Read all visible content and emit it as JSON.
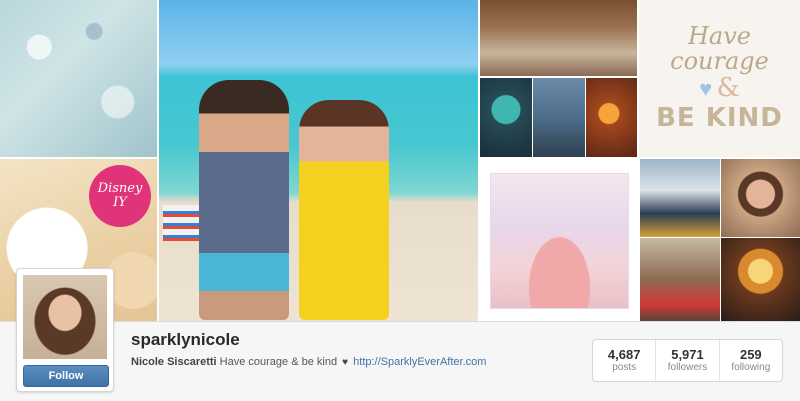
{
  "colors": {
    "follow_button": "#3f72a6",
    "link": "#3f72a6",
    "disney_badge": "#e0337a",
    "profile_bar_bg": "#f6f6f6"
  },
  "mosaic": {
    "disney_badge": {
      "line1": "Disney",
      "line2": "IY"
    },
    "courage_art": {
      "line1": "Have",
      "line2": "courage",
      "amp": "&",
      "line3": "BE KIND"
    }
  },
  "profile": {
    "username": "sparklynicole",
    "full_name": "Nicole Siscaretti",
    "bio": "Have courage & be kind",
    "heart_icon": "heart-icon",
    "website": "http://SparklyEverAfter.com",
    "follow_label": "Follow"
  },
  "stats": [
    {
      "value": "4,687",
      "label": "posts"
    },
    {
      "value": "5,971",
      "label": "followers"
    },
    {
      "value": "259",
      "label": "following"
    }
  ]
}
